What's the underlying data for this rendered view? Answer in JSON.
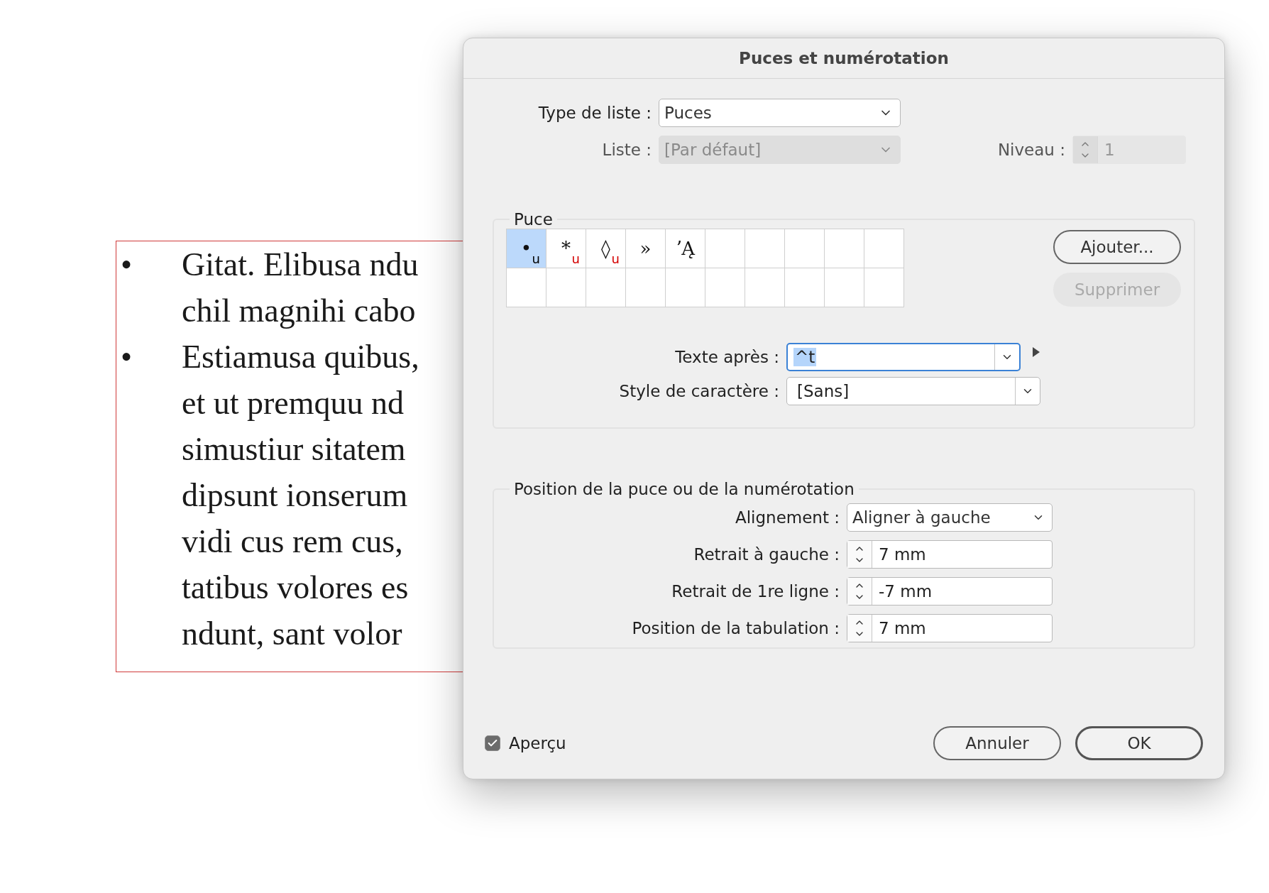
{
  "document": {
    "paragraphs": [
      {
        "bullet": "•",
        "lines": [
          "Gitat. Elibusa ndu",
          "chil magnihi cabo"
        ]
      },
      {
        "bullet": "•",
        "lines": [
          "Estiamusa quibus,",
          "et ut premquu nd",
          "simustiur sitatem",
          "dipsunt ionserum",
          "vidi cus rem cus,",
          "tatibus volores es",
          "ndunt, sant volor"
        ]
      }
    ]
  },
  "dialog": {
    "title": "Puces et numérotation",
    "list_type": {
      "label": "Type de liste :",
      "value": "Puces",
      "disabled": false
    },
    "list": {
      "label": "Liste :",
      "value": "[Par défaut]",
      "disabled": true
    },
    "level": {
      "label": "Niveau :",
      "value": "1",
      "disabled": true
    },
    "bullet_group": {
      "legend": "Puce",
      "bullets": [
        {
          "glyph": "•",
          "font_flag": "u",
          "color": "#000000",
          "selected": true
        },
        {
          "glyph": "*",
          "font_flag": "u",
          "color": "#d40000",
          "selected": false
        },
        {
          "glyph": "◊",
          "font_flag": "u",
          "color": "#d40000",
          "selected": false
        },
        {
          "glyph": "»",
          "selected": false
        },
        {
          "glyph": "ʼĄ",
          "selected": false
        }
      ],
      "buttons": [
        {
          "label": "Ajouter...",
          "disabled": false
        },
        {
          "label": "Supprimer",
          "disabled": true
        }
      ],
      "text_after": {
        "label": "Texte après :",
        "value": "^t",
        "focused": true,
        "value_selected": true
      },
      "char_style": {
        "label": "Style de caractère :",
        "value": "[Sans]"
      }
    },
    "position_group": {
      "legend": "Position de la puce ou de la numérotation",
      "alignment": {
        "label": "Alignement :",
        "value": "Aligner à gauche"
      },
      "fields": [
        {
          "label": "Retrait à gauche :",
          "value": "7 mm"
        },
        {
          "label": "Retrait de 1re ligne :",
          "value": "-7 mm"
        },
        {
          "label": "Position de la tabulation :",
          "value": "7 mm"
        }
      ]
    },
    "preview": {
      "label": "Aperçu",
      "checked": true
    },
    "buttons": [
      {
        "label": "Annuler",
        "default": false
      },
      {
        "label": "OK",
        "default": true
      }
    ]
  }
}
